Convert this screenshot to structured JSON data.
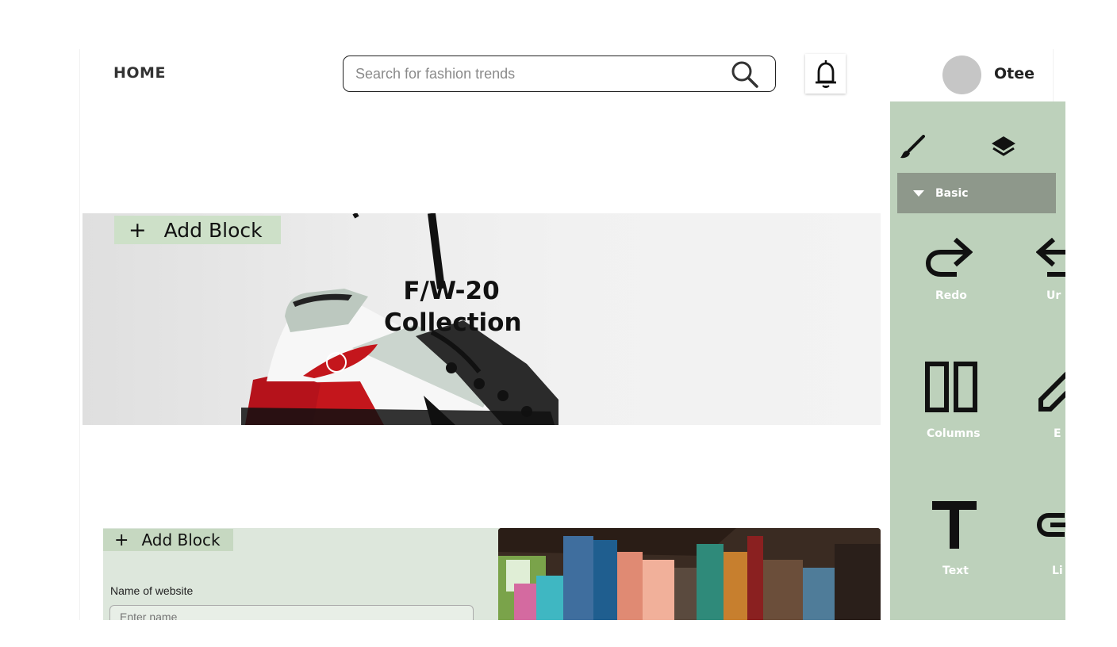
{
  "header": {
    "home_label": "HOME",
    "search_placeholder": "Search for fashion trends",
    "username": "Otee"
  },
  "hero": {
    "title_line1": "F/W-20",
    "title_line2": "Collection",
    "add_block_label": "Add Block"
  },
  "section2": {
    "add_block_label": "Add Block",
    "name_label": "Name of website",
    "name_placeholder": "Enter name"
  },
  "editor": {
    "category": "Basic",
    "blocks": [
      {
        "label": "Redo",
        "icon": "redo-icon"
      },
      {
        "label": "Ur",
        "icon": "undo-icon"
      },
      {
        "label": "Columns",
        "icon": "columns-icon"
      },
      {
        "label": "E",
        "icon": "edit-icon"
      },
      {
        "label": "Text",
        "icon": "text-icon"
      },
      {
        "label": "Li",
        "icon": "link-icon"
      }
    ]
  },
  "colors": {
    "panel_bg": "#bdd1bb",
    "category_bar": "#8e988b",
    "add_block_bg": "#cde0c8",
    "section_bg": "#dde7dc"
  }
}
